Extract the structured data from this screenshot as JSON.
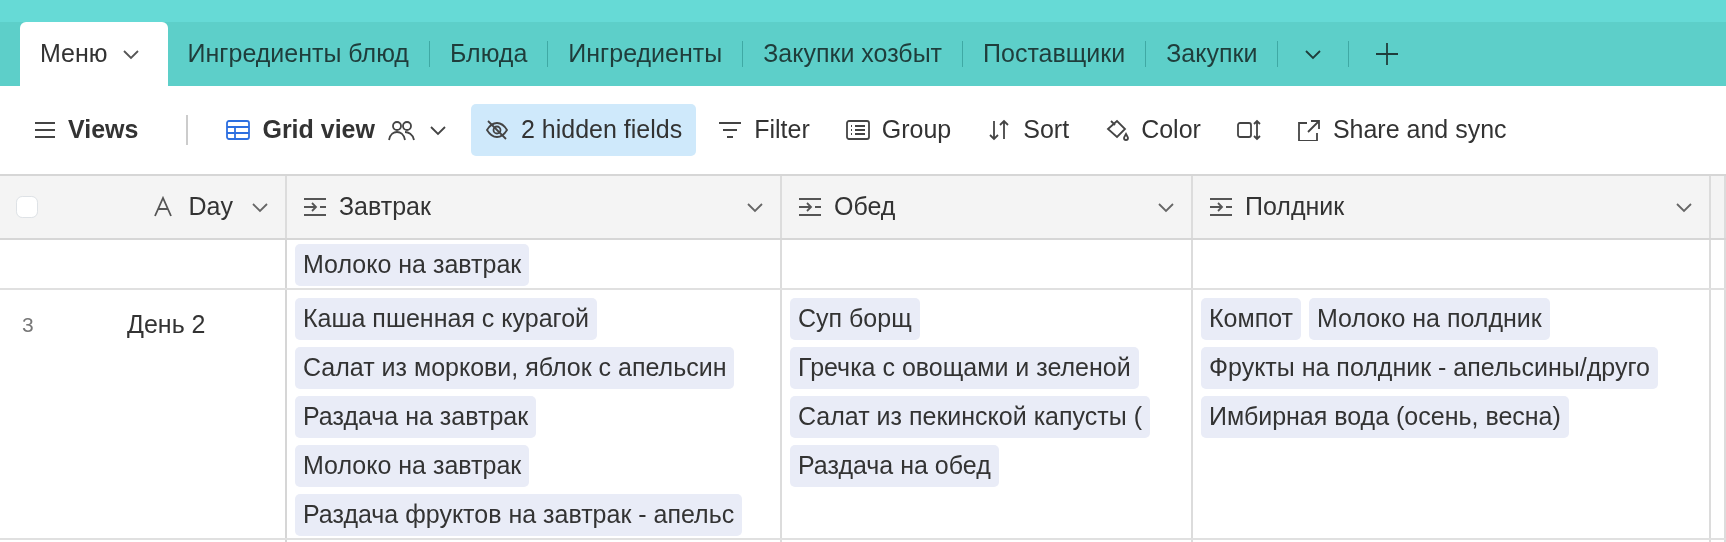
{
  "tabs": [
    {
      "label": "Меню",
      "selected": true
    },
    {
      "label": "Ингредиенты блюд",
      "selected": false
    },
    {
      "label": "Блюда",
      "selected": false
    },
    {
      "label": "Ингредиенты",
      "selected": false
    },
    {
      "label": "Закупки хозбыт",
      "selected": false
    },
    {
      "label": "Поставщики",
      "selected": false
    },
    {
      "label": "Закупки",
      "selected": false
    }
  ],
  "toolbar": {
    "views": "Views",
    "view_name": "Grid view",
    "buttons": [
      {
        "kind": "hidden",
        "label": "2 hidden fields",
        "highlighted": true
      },
      {
        "kind": "filter",
        "label": "Filter",
        "highlighted": false
      },
      {
        "kind": "group",
        "label": "Group",
        "highlighted": false
      },
      {
        "kind": "sort",
        "label": "Sort",
        "highlighted": false
      },
      {
        "kind": "color",
        "label": "Color",
        "highlighted": false
      },
      {
        "kind": "row-height",
        "highlighted": false
      },
      {
        "kind": "share",
        "label": "Share and sync",
        "highlighted": false
      }
    ]
  },
  "table": {
    "select_all": {
      "checked": false
    },
    "columns": [
      {
        "kind": "text",
        "label": "Day"
      },
      {
        "kind": "link",
        "label": "Завтрак"
      },
      {
        "kind": "link",
        "label": "Обед"
      },
      {
        "kind": "link",
        "label": "Полдник"
      }
    ],
    "rows": [
      {
        "cut_off": true,
        "cells": [
          "",
          [
            "Молоко на завтрак"
          ],
          [],
          []
        ]
      },
      {
        "cut_off": false,
        "number": "3",
        "cells": [
          "День 2",
          [
            "Каша пшенная с курагой",
            "Салат из моркови, яблок с апельсин",
            "Раздача на завтрак",
            "Молоко на завтрак",
            "Раздача фруктов на завтрак - апельс"
          ],
          [
            "Суп борщ",
            "Гречка с овощами и зеленой",
            "Салат из пекинской капусты (",
            "Раздача на обед"
          ],
          [
            "Компот",
            "Молоко на полдник",
            "Фрукты на полдник - апельсины/друго",
            "Имбирная вода (осень, весна)"
          ]
        ]
      }
    ]
  }
}
